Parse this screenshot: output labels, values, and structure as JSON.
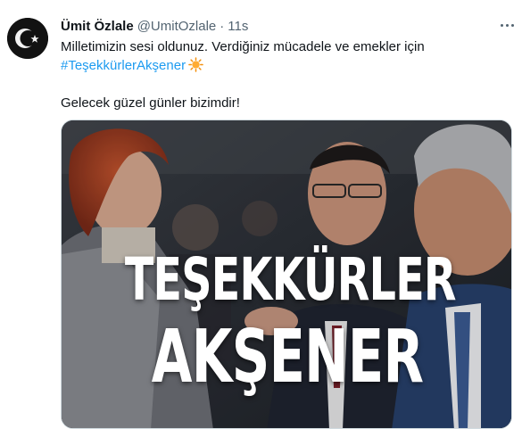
{
  "tweet": {
    "display_name": "Ümit Özlale",
    "handle": "@UmitOzlale",
    "separator": "·",
    "time": "11s",
    "text_line1": "Milletimizin sesi oldunuz. Verdiğiniz mücadele ve emekler için",
    "hashtag": "#TeşekkürlerAkşener",
    "emoji": "sun-emoji",
    "text_line2": "Gelecek güzel günler bizimdir!",
    "avatar_icon": "crescent-star-icon",
    "more_icon": "more-options-icon"
  },
  "media": {
    "overlay_line1": "TEŞEKKÜRLER",
    "overlay_line2": "AKŞENER"
  },
  "colors": {
    "link": "#1d9bf0",
    "secondary_text": "#536471",
    "primary_text": "#0f1419",
    "border": "#cfd9de"
  }
}
